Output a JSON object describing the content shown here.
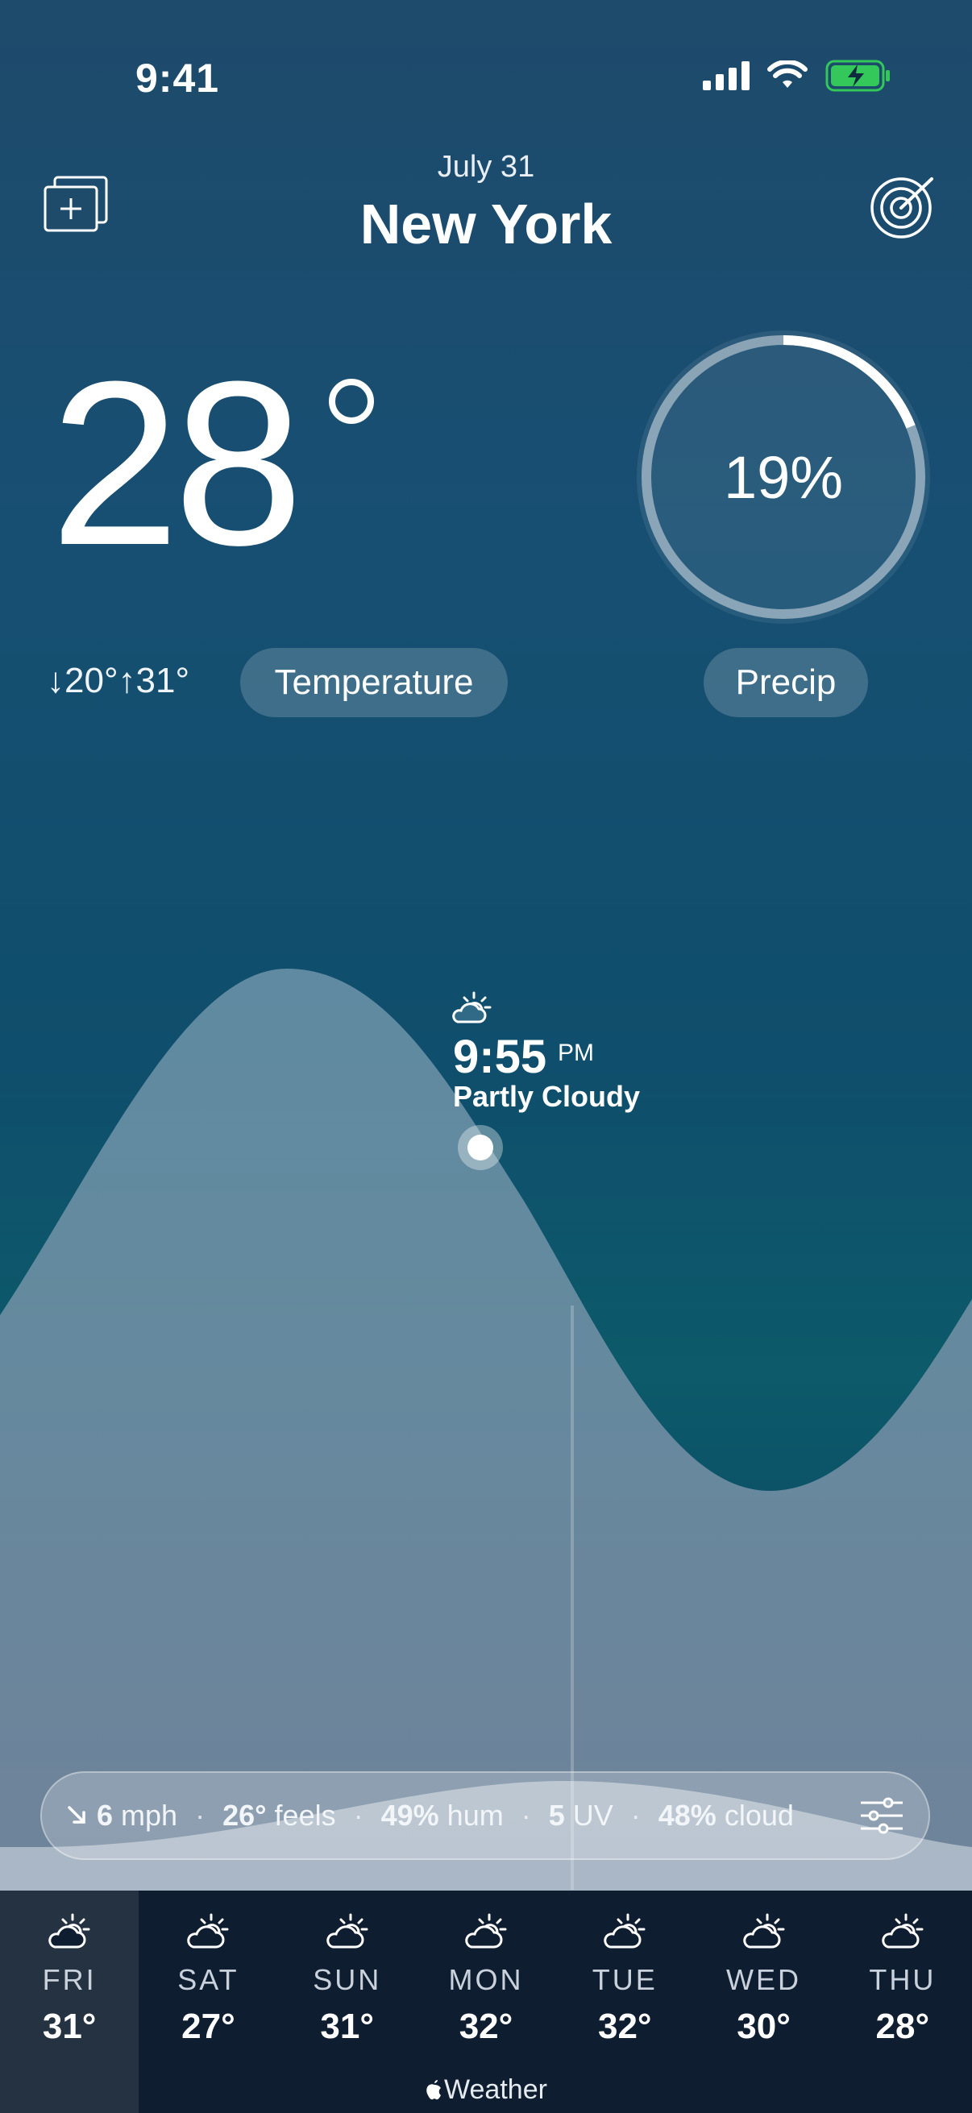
{
  "status": {
    "time": "9:41"
  },
  "header": {
    "date": "July 31",
    "city": "New York"
  },
  "current": {
    "temp": "28",
    "low_high": "↓20°↑31°",
    "temp_pill": "Temperature",
    "precip_percent": "19%",
    "precip_value": 0.19,
    "precip_pill": "Precip"
  },
  "marker": {
    "time": "9:55",
    "ampm": "PM",
    "condition": "Partly Cloudy"
  },
  "details": {
    "wind_value": "6",
    "wind_unit": "mph",
    "feels_value": "26°",
    "feels_unit": "feels",
    "hum_value": "49%",
    "hum_unit": "hum",
    "uv_value": "5",
    "uv_unit": "UV",
    "cloud_value": "48%",
    "cloud_unit": "cloud"
  },
  "forecast": [
    {
      "day": "FRI",
      "temp": "31°",
      "icon": "partly-cloudy-icon"
    },
    {
      "day": "SAT",
      "temp": "27°",
      "icon": "partly-cloudy-icon"
    },
    {
      "day": "SUN",
      "temp": "31°",
      "icon": "partly-cloudy-icon"
    },
    {
      "day": "MON",
      "temp": "32°",
      "icon": "partly-cloudy-icon"
    },
    {
      "day": "TUE",
      "temp": "32°",
      "icon": "partly-cloudy-icon"
    },
    {
      "day": "WED",
      "temp": "30°",
      "icon": "partly-cloudy-icon"
    },
    {
      "day": "THU",
      "temp": "28°",
      "icon": "partly-cloudy-icon"
    }
  ],
  "brand": "Weather",
  "colors": {
    "battery": "#34c759",
    "forecast_bg": "#0f1d30"
  }
}
